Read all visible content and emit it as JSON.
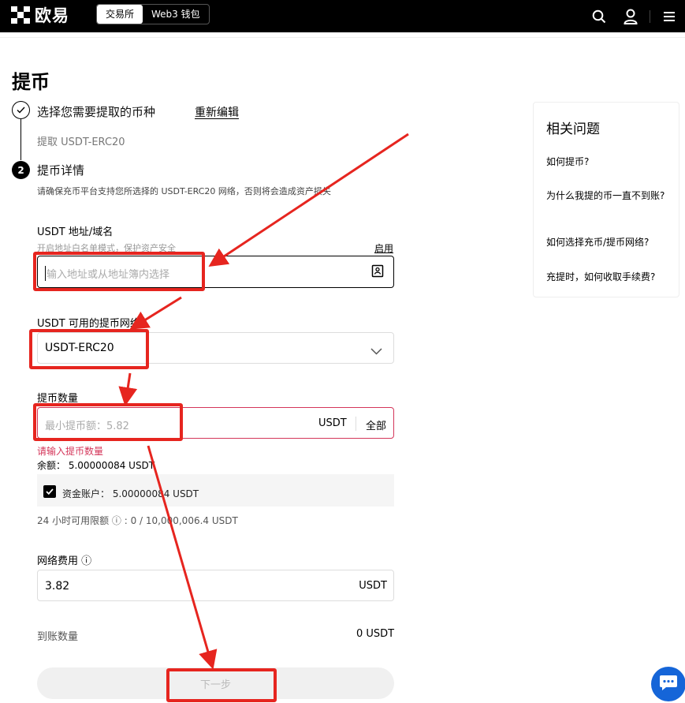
{
  "header": {
    "brand_name": "欧易",
    "tabs": [
      "交易所",
      "Web3 钱包"
    ],
    "icons": [
      "search-icon",
      "user-icon",
      "menu-icon"
    ]
  },
  "page": {
    "title": "提币"
  },
  "steps": {
    "step1_title": "选择您需要提取的币种",
    "re_edit": "重新编辑",
    "step1_sub": "提取 USDT-ERC20",
    "step2_number": "2",
    "step2_title": "提币详情",
    "step2_note": "请确保充币平台支持您所选择的 USDT-ERC20 网络，否则将会造成资产损失"
  },
  "form": {
    "address_label": "USDT 地址/域名",
    "address_hint": "开启地址白名单模式，保护资产安全",
    "address_enable": "启用",
    "address_placeholder": "输入地址或从地址簿内选择",
    "network_label": "USDT 可用的提币网络",
    "network_value": "USDT-ERC20",
    "amount_label": "提币数量",
    "amount_placeholder": "最小提币额：5.82",
    "amount_unit": "USDT",
    "amount_all": "全部",
    "amount_error": "请输入提币数量",
    "balance": "余额：  5.00000084 USDT",
    "fund_account": "资金账户：  5.00000084 USDT",
    "fund_checked": true,
    "limit": "24 小时可用限额 ⓘ : 0 / 10,000,006.4 USDT",
    "fee_label": "网络费用 ⓘ",
    "fee_value": "3.82",
    "fee_unit": "USDT",
    "arrive_label": "到账数量",
    "arrive_value": "0 USDT",
    "next_button": "下一步"
  },
  "side_panel": {
    "title": "相关问题",
    "questions": [
      "如何提币?",
      "为什么我提的币一直不到账?",
      "如何选择充币/提币网络?",
      "充提时，如何收取手续费?"
    ]
  },
  "colors": {
    "annotation": "#e6251f",
    "error": "#d4365a",
    "chat": "#1565d8"
  }
}
